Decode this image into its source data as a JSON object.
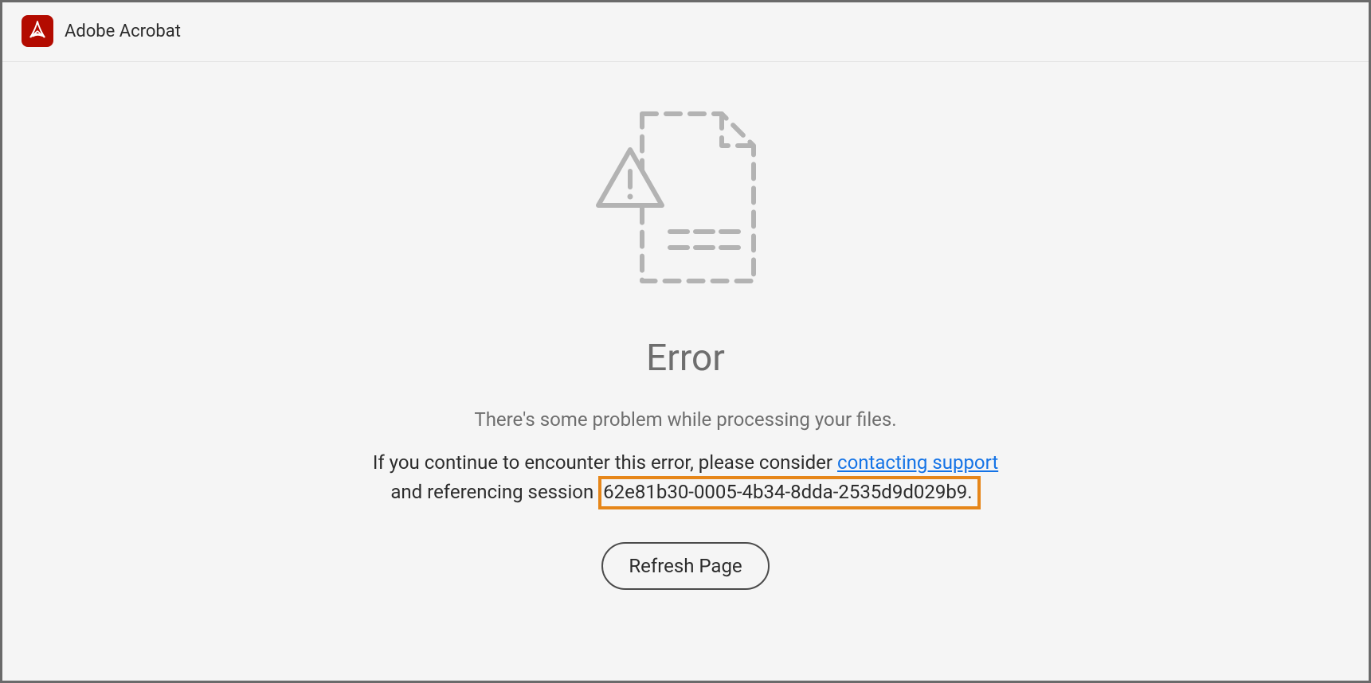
{
  "app": {
    "title": "Adobe Acrobat"
  },
  "error": {
    "heading": "Error",
    "subtext": "There's some problem while processing your files.",
    "body_prefix": "If you continue to encounter this error, please consider ",
    "support_link_text": "contacting support",
    "body_middle": " and referencing session ",
    "session_id": "62e81b30-0005-4b34-8dda-2535d9d029b9.",
    "refresh_label": "Refresh Page"
  }
}
